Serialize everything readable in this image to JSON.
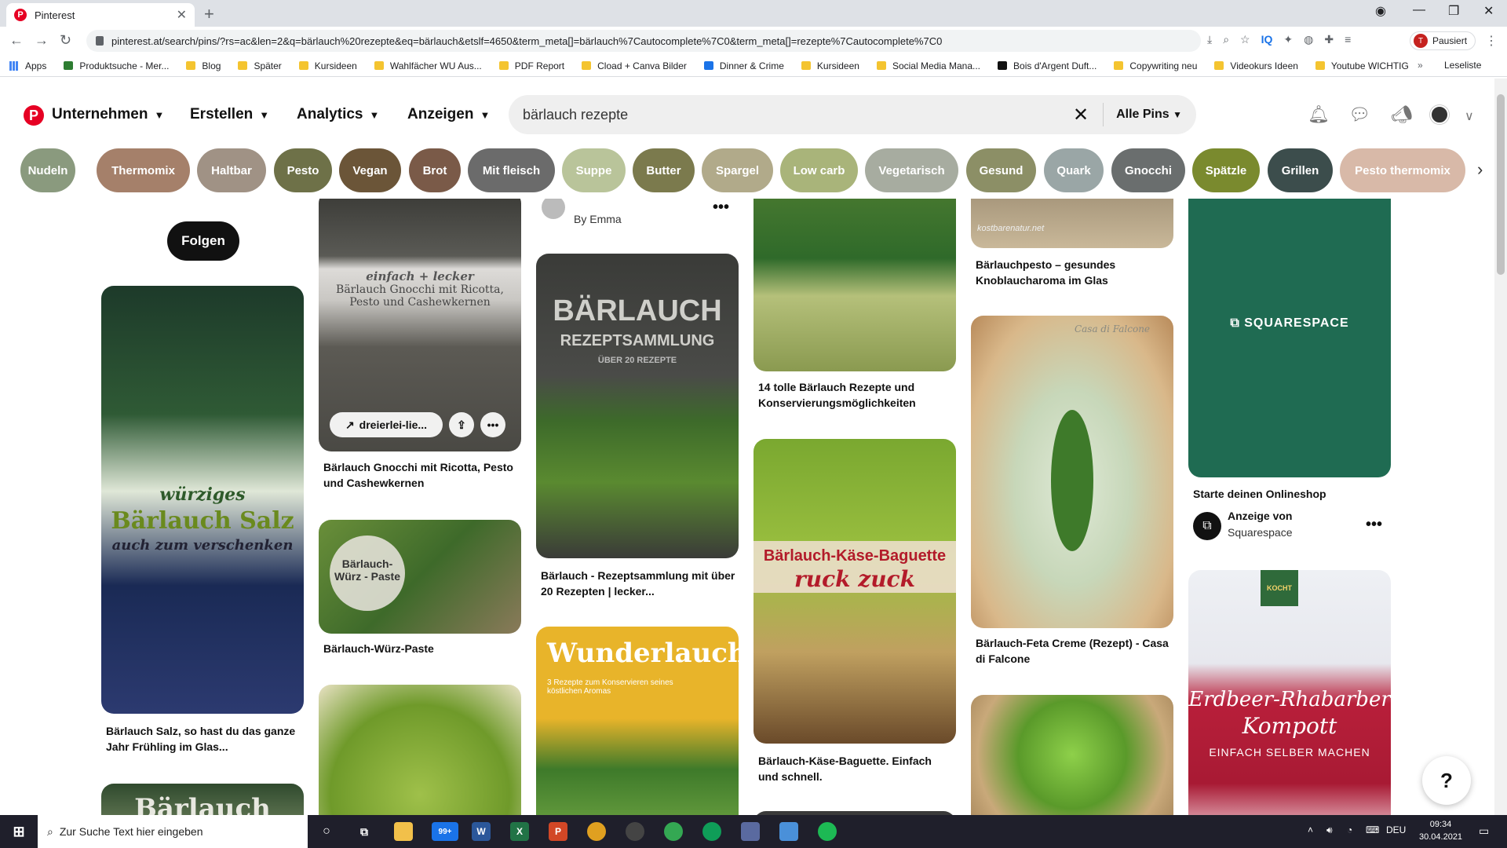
{
  "browser": {
    "tab_title": "Pinterest",
    "new_tab": "+",
    "url": "pinterest.at/search/pins/?rs=ac&len=2&q=bärlauch%20rezepte&eq=bärlauch&etslf=4650&term_meta[]=bärlauch%7Cautocomplete%7C0&term_meta[]=rezepte%7Cautocomplete%7C0",
    "profile_label": "Pausiert",
    "profile_initial": "T",
    "bookmarks": [
      "Apps",
      "Produktsuche - Mer...",
      "Blog",
      "Später",
      "Kursideen",
      "Wahlfächer WU Aus...",
      "PDF Report",
      "Cload + Canva Bilder",
      "Dinner & Crime",
      "Kursideen",
      "Social Media Mana...",
      "Bois d'Argent Duft...",
      "Copywriting neu",
      "Videokurs Ideen",
      "Youtube WICHTIG"
    ],
    "bookmarks_more": "»",
    "reading_list": "Leseliste"
  },
  "pinterest": {
    "logo": "P",
    "nav": [
      "Unternehmen",
      "Erstellen",
      "Analytics",
      "Anzeigen"
    ],
    "search_value": "bärlauch rezepte",
    "search_filter": "Alle Pins",
    "chips": [
      {
        "label": "Nudeln",
        "color": "#8a9a7e"
      },
      {
        "label": "Thermomix",
        "color": "#a5806a"
      },
      {
        "label": "Haltbar",
        "color": "#a09285"
      },
      {
        "label": "Pesto",
        "color": "#6e7148"
      },
      {
        "label": "Vegan",
        "color": "#6b5538"
      },
      {
        "label": "Brot",
        "color": "#7a5a48"
      },
      {
        "label": "Mit fleisch",
        "color": "#6b6b6b"
      },
      {
        "label": "Suppe",
        "color": "#b9c49a"
      },
      {
        "label": "Butter",
        "color": "#7b7a4d"
      },
      {
        "label": "Spargel",
        "color": "#b1aa8a"
      },
      {
        "label": "Low carb",
        "color": "#a9b47a"
      },
      {
        "label": "Vegetarisch",
        "color": "#a7aca0"
      },
      {
        "label": "Gesund",
        "color": "#8c8f66"
      },
      {
        "label": "Quark",
        "color": "#9aa6a6"
      },
      {
        "label": "Gnocchi",
        "color": "#6a6e6e"
      },
      {
        "label": "Spätzle",
        "color": "#7a8a2e"
      },
      {
        "label": "Grillen",
        "color": "#3c4d4c"
      },
      {
        "label": "Pesto thermomix",
        "color": "#d8b9a8"
      }
    ],
    "follow_label": "Folgen",
    "pins": {
      "salz": {
        "title": "Bärlauch Salz, so hast du das ganze Jahr Frühling im Glas...",
        "overlay1": "würziges",
        "overlay2": "Bärlauch Salz",
        "overlay3": "auch zum verschenken"
      },
      "col1_bottom_overlay": "Bärlauch",
      "gnocchi": {
        "title": "Bärlauch Gnocchi mit Ricotta, Pesto und Cashewkernen",
        "overlay": "Bärlauch Gnocchi mit Ricotta, Pesto und Cashewkernen",
        "overlay_top": "einfach + lecker",
        "link_label": "dreierlei-lie..."
      },
      "paste": {
        "title": "Bärlauch-Würz-Paste",
        "overlay": "Bärlauch-Würz - Paste"
      },
      "emma": {
        "by": "By Emma"
      },
      "rezeptsammlung": {
        "title": "Bärlauch - Rezeptsammlung mit über 20 Rezepten | lecker...",
        "overlay1": "BÄRLAUCH",
        "overlay2": "REZEPTSAMMLUNG",
        "overlay3": "ÜBER 20 REZEPTE"
      },
      "wunderlauch": {
        "overlay1": "Wunderlauch",
        "overlay2": "3 Rezepte zum Konservieren seines köstlichen Aromas"
      },
      "konservierung": {
        "title": "14 tolle Bärlauch Rezepte und Konservierungsmöglichkeiten"
      },
      "baguette": {
        "title": "Bärlauch-Käse-Baguette. Einfach und schnell.",
        "overlay1": "Bärlauch-Käse-Baguette",
        "overlay2": "ruck zuck"
      },
      "pesto": {
        "title": "Bärlauchpesto – gesundes Knoblaucharoma im Glas",
        "watermark": "kostbarenatur.net"
      },
      "feta": {
        "title": "Bärlauch-Feta Creme (Rezept) - Casa di Falcone",
        "watermark": "Casa di Falcone"
      },
      "squarespace": {
        "title": "Starte deinen Onlineshop",
        "ad_label": "Anzeige von",
        "advertiser": "Squarespace",
        "brand": "SQUARESPACE"
      },
      "kompott": {
        "overlay1": "Erdbeer-Rhabarber",
        "overlay2": "Kompott",
        "overlay3": "EINFACH SELBER MACHEN",
        "badge": "KOCHT"
      }
    },
    "help": "?"
  },
  "taskbar": {
    "search_placeholder": "Zur Suche Text hier eingeben",
    "mail_badge": "99+",
    "lang": "DEU",
    "time": "09:34",
    "date": "30.04.2021"
  },
  "colors": {
    "pinterest_red": "#e60023",
    "squarespace_green": "#1f6b52"
  }
}
